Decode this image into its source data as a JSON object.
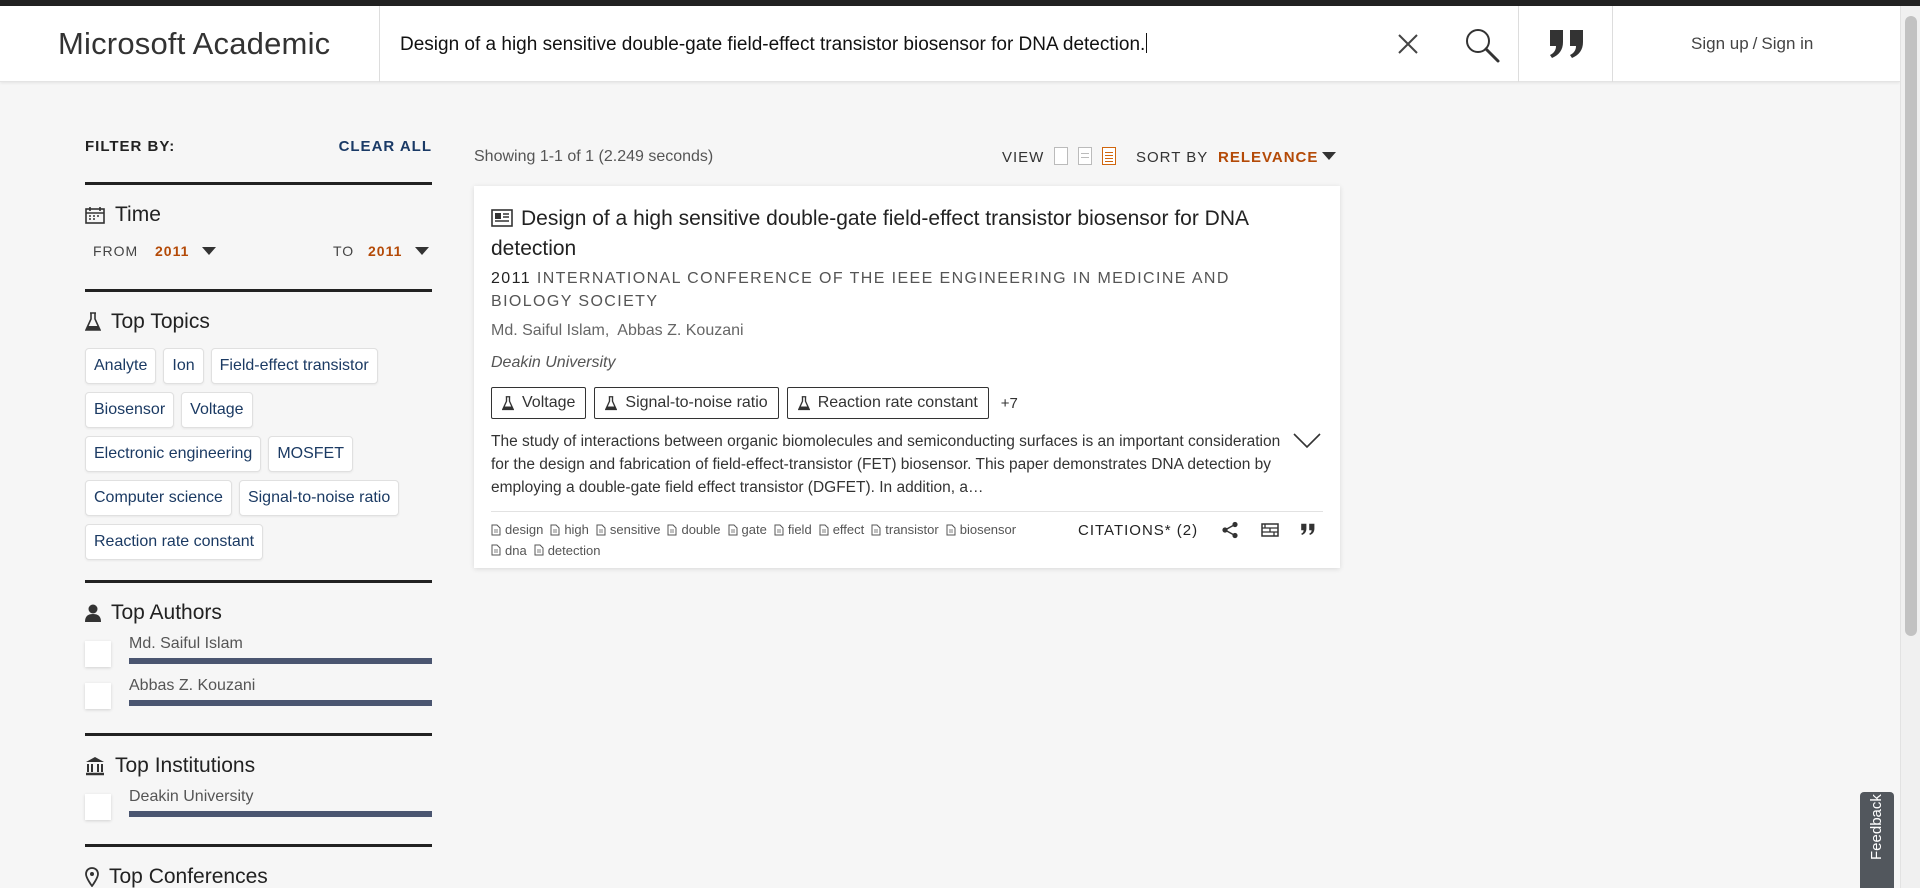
{
  "header": {
    "logo": "Microsoft Academic",
    "search_value": "Design of a high sensitive double-gate field-effect transistor biosensor for DNA detection.",
    "signup": "Sign up",
    "sep": "/",
    "signin": "Sign in"
  },
  "sidebar": {
    "filter_by": "FILTER BY:",
    "clear_all": "CLEAR ALL",
    "time": {
      "title": "Time",
      "from_label": "FROM",
      "from_value": "2011",
      "to_label": "TO",
      "to_value": "2011"
    },
    "topics": {
      "title": "Top Topics",
      "items": [
        "Analyte",
        "Ion",
        "Field-effect transistor",
        "Biosensor",
        "Voltage",
        "Electronic engineering",
        "MOSFET",
        "Computer science",
        "Signal-to-noise ratio",
        "Reaction rate constant"
      ]
    },
    "authors": {
      "title": "Top Authors",
      "items": [
        "Md. Saiful Islam",
        "Abbas Z. Kouzani"
      ]
    },
    "institutions": {
      "title": "Top Institutions",
      "items": [
        "Deakin University"
      ]
    },
    "conferences": {
      "title": "Top Conferences"
    }
  },
  "results": {
    "showing": "Showing 1-1 of 1 (2.249 seconds)",
    "view_label": "VIEW",
    "sort_label": "SORT BY",
    "sort_value": "RELEVANCE"
  },
  "paper": {
    "title": "Design of a high sensitive double-gate field-effect transistor biosensor for DNA detection",
    "year": "2011",
    "venue": "INTERNATIONAL CONFERENCE OF THE IEEE ENGINEERING IN MEDICINE AND BIOLOGY SOCIETY",
    "authors": [
      "Md. Saiful Islam,",
      "Abbas Z. Kouzani"
    ],
    "affiliation": "Deakin University",
    "tags": [
      "Voltage",
      "Signal-to-noise ratio",
      "Reaction rate constant"
    ],
    "more_tags": "+7",
    "abstract": "The study of interactions between organic biomolecules and semiconducting surfaces is an important consideration for the design and fabrication of field-effect-transistor (FET) biosensor. This paper demonstrates DNA detection by employing a double-gate field effect transistor (DGFET). In addition, a…",
    "keywords": [
      "design",
      "high",
      "sensitive",
      "double",
      "gate",
      "field",
      "effect",
      "transistor",
      "biosensor",
      "dna",
      "detection"
    ],
    "citations": "CITATIONS* (2)"
  },
  "feedback": "Feedback",
  "colors": {
    "accent": "#b44a07",
    "link": "#1b3a63",
    "bar": "#4a5570"
  }
}
